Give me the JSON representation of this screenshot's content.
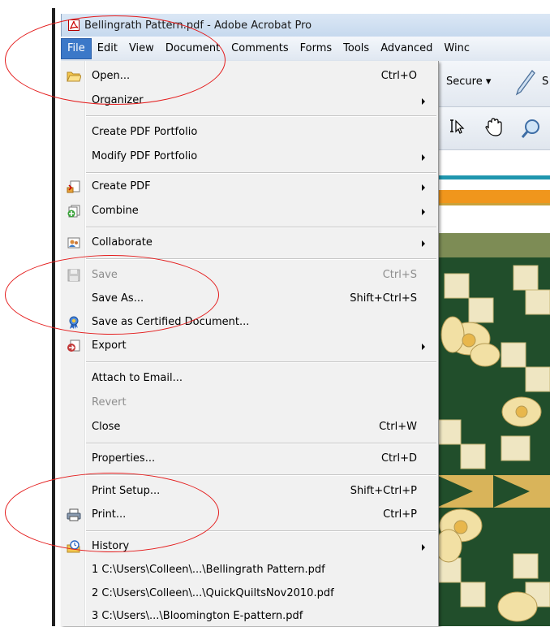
{
  "window": {
    "title": "Bellingrath Pattern.pdf - Adobe Acrobat Pro"
  },
  "menubar": {
    "items": [
      "File",
      "Edit",
      "View",
      "Document",
      "Comments",
      "Forms",
      "Tools",
      "Advanced",
      "Winc"
    ],
    "active": "File"
  },
  "toolbar": {
    "secure_label": "Secure ▾",
    "sign_label_partial": "S"
  },
  "file_menu": {
    "items": [
      {
        "label": "Open...",
        "shortcut": "Ctrl+O",
        "icon": "folder-icon",
        "submenu": false,
        "disabled": false
      },
      {
        "label": "Organizer",
        "shortcut": "",
        "icon": "",
        "submenu": true,
        "disabled": false
      },
      {
        "label": "Create PDF Portfolio",
        "shortcut": "",
        "icon": "",
        "submenu": false,
        "disabled": false
      },
      {
        "label": "Modify PDF Portfolio",
        "shortcut": "",
        "icon": "",
        "submenu": true,
        "disabled": false
      },
      {
        "label": "Create PDF",
        "shortcut": "",
        "icon": "create-pdf-icon",
        "submenu": true,
        "disabled": false
      },
      {
        "label": "Combine",
        "shortcut": "",
        "icon": "combine-icon",
        "submenu": true,
        "disabled": false
      },
      {
        "label": "Collaborate",
        "shortcut": "",
        "icon": "collaborate-icon",
        "submenu": true,
        "disabled": false
      },
      {
        "label": "Save",
        "shortcut": "Ctrl+S",
        "icon": "save-icon",
        "submenu": false,
        "disabled": true
      },
      {
        "label": "Save As...",
        "shortcut": "Shift+Ctrl+S",
        "icon": "",
        "submenu": false,
        "disabled": false
      },
      {
        "label": "Save as Certified Document...",
        "shortcut": "",
        "icon": "certified-ribbon-icon",
        "submenu": false,
        "disabled": false
      },
      {
        "label": "Export",
        "shortcut": "",
        "icon": "export-icon",
        "submenu": true,
        "disabled": false
      },
      {
        "label": "Attach to Email...",
        "shortcut": "",
        "icon": "",
        "submenu": false,
        "disabled": false
      },
      {
        "label": "Revert",
        "shortcut": "",
        "icon": "",
        "submenu": false,
        "disabled": true
      },
      {
        "label": "Close",
        "shortcut": "Ctrl+W",
        "icon": "",
        "submenu": false,
        "disabled": false
      },
      {
        "label": "Properties...",
        "shortcut": "Ctrl+D",
        "icon": "",
        "submenu": false,
        "disabled": false
      },
      {
        "label": "Print Setup...",
        "shortcut": "Shift+Ctrl+P",
        "icon": "",
        "submenu": false,
        "disabled": false
      },
      {
        "label": "Print...",
        "shortcut": "Ctrl+P",
        "icon": "printer-icon",
        "submenu": false,
        "disabled": false
      },
      {
        "label": "History",
        "shortcut": "",
        "icon": "history-icon",
        "submenu": true,
        "disabled": false
      },
      {
        "label": "1 C:\\Users\\Colleen\\...\\Bellingrath Pattern.pdf",
        "shortcut": "",
        "icon": "",
        "submenu": false,
        "disabled": false
      },
      {
        "label": "2 C:\\Users\\Colleen\\...\\QuickQuiltsNov2010.pdf",
        "shortcut": "",
        "icon": "",
        "submenu": false,
        "disabled": false
      },
      {
        "label": "3 C:\\Users\\...\\Bloomington E-pattern.pdf",
        "shortcut": "",
        "icon": "",
        "submenu": false,
        "disabled": false
      }
    ]
  },
  "colors": {
    "menu_highlight": "#3b78c8",
    "annotation_red": "#e41b1b",
    "disabled_text": "#8d8d8d"
  }
}
